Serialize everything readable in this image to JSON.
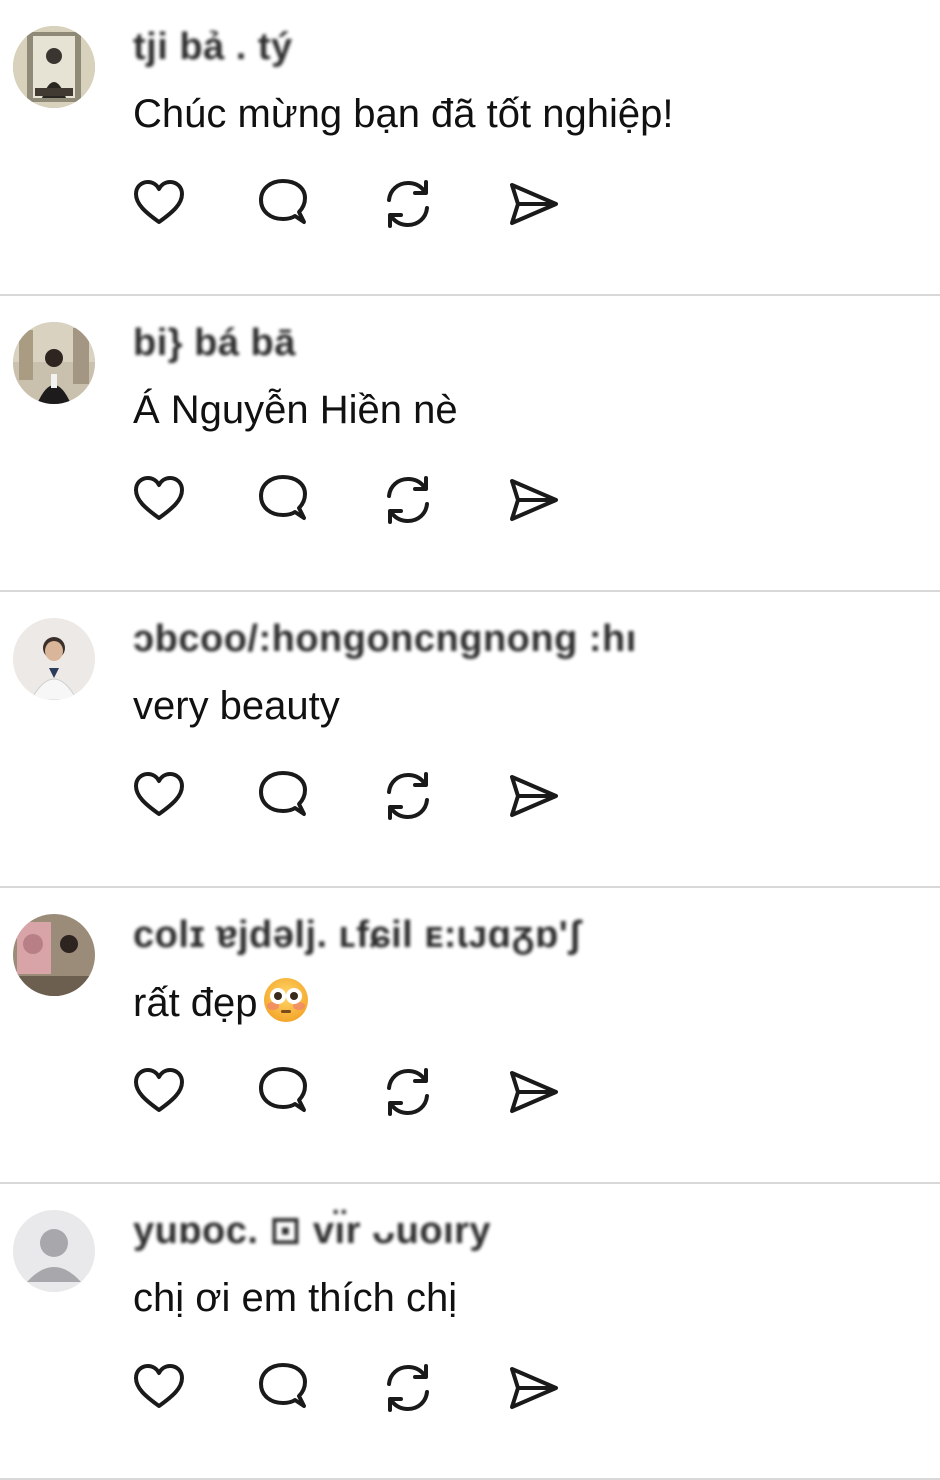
{
  "replies": [
    {
      "username": "tji bả . tý",
      "comment": "Chúc mừng bạn đã tốt nghiệp!",
      "avatar": "photo-person-mirror"
    },
    {
      "username": "bi} bá bā",
      "comment": "Á Nguyễn Hiền nè",
      "avatar": "photo-person-suit-interior"
    },
    {
      "username": "ɔbcoo/:hongoncngnong  :hı",
      "comment": "very beauty",
      "avatar": "photo-person-white-coat"
    },
    {
      "username": "colɪ ɐjdəlj. ʟfɕil ᴇ:ɩᴊɑᵹɒ'ʃ",
      "comment": "rất đẹp",
      "emoji": "flushed-face-emoji",
      "avatar": "photo-person-painting"
    },
    {
      "username": "yuɒoc. ⊡ vı̈r ᴗuoıry",
      "comment": "chị ơi em thích chị",
      "avatar": "default-user-avatar"
    }
  ],
  "icons": {
    "like": "heart-icon",
    "comment": "speech-bubble-icon",
    "repost": "repost-arrows-icon",
    "share": "send-paper-plane-icon"
  },
  "colors": {
    "divider": "#d8d8d8",
    "text": "#111111",
    "icon_stroke": "#1a1a1a"
  }
}
